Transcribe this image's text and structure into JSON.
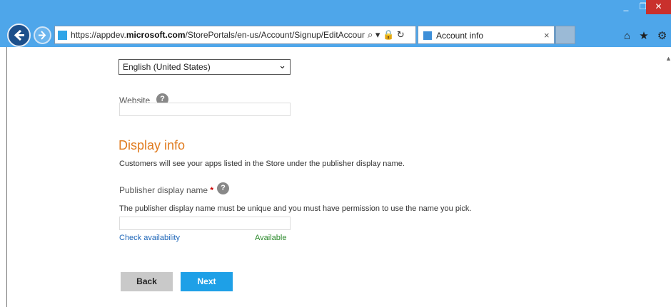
{
  "window": {
    "min_glyph": "_",
    "max_glyph": "❐",
    "close_glyph": "✕"
  },
  "browser": {
    "url_prefix": "https://appdev.",
    "url_domain": "microsoft.com",
    "url_path": "/StorePortals/en-us/Account/Signup/EditAccount",
    "address_tools": "⌕ ▾ 🔒 ↻",
    "tab_title": "Account info",
    "tab_close": "×",
    "right_tools": "⌂ ★ ⚙"
  },
  "form": {
    "language_value": "English (United States)",
    "language_chevron": "⌄",
    "website_label": "Website",
    "help_glyph": "?",
    "display_info_heading": "Display info",
    "display_info_desc": "Customers will see your apps listed in the Store under the publisher display name.",
    "publisher_label": "Publisher display name",
    "required_marker": "*",
    "publisher_desc": "The publisher display name must be unique and you must have permission to use the name you pick.",
    "publisher_value": "",
    "check_availability": "Check availability",
    "availability_status": "Available",
    "back_label": "Back",
    "next_label": "Next"
  },
  "colors": {
    "chrome_blue": "#4ea6ea",
    "heading_orange": "#e07b1f",
    "link_blue": "#1e66b8",
    "available_green": "#2b8a2b",
    "next_button": "#1ea0e7",
    "back_button": "#c9c9c9",
    "close_red": "#c9302c"
  }
}
